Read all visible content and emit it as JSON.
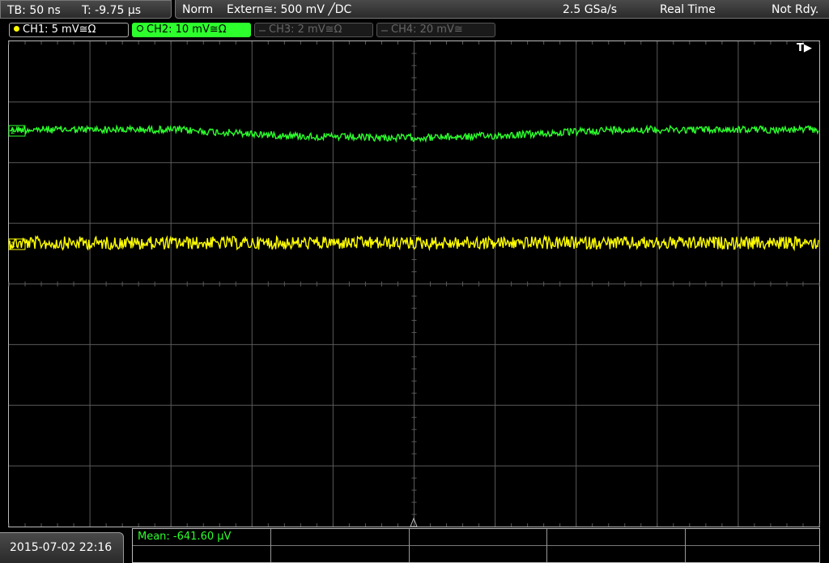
{
  "header": {
    "timebase": "TB: 50 ns",
    "trigger_time": "T: -9.75 µs",
    "mode": "Norm",
    "trigger_source": "Extern≅: 500 mV ╱DC",
    "sample_rate": "2.5 GSa/s",
    "acq_mode": "Real Time",
    "status": "Not Rdy."
  },
  "channels": [
    {
      "label": "CH1: 5 mV≅Ω",
      "color": "#ffff00",
      "active": false,
      "enabled": true
    },
    {
      "label": "CH2: 10 mV≅Ω",
      "color": "#2dff2d",
      "active": true,
      "enabled": true
    },
    {
      "label": "CH3: 2 mV≅Ω",
      "color": "#666666",
      "active": false,
      "enabled": false
    },
    {
      "label": "CH4: 20 mV≅",
      "color": "#666666",
      "active": false,
      "enabled": false
    }
  ],
  "trigger_indicator": "T▶",
  "measurement": {
    "label": "Mean: -641.60 µV"
  },
  "footer": {
    "datetime": "2015-07-02 22:16"
  },
  "colors": {
    "ch1": "#ffff00",
    "ch2": "#2dff2d",
    "grid": "#5a5a5a"
  },
  "icons": [
    "channel-dot-icon",
    "trigger-position-icon",
    "channel-marker-icon"
  ]
}
